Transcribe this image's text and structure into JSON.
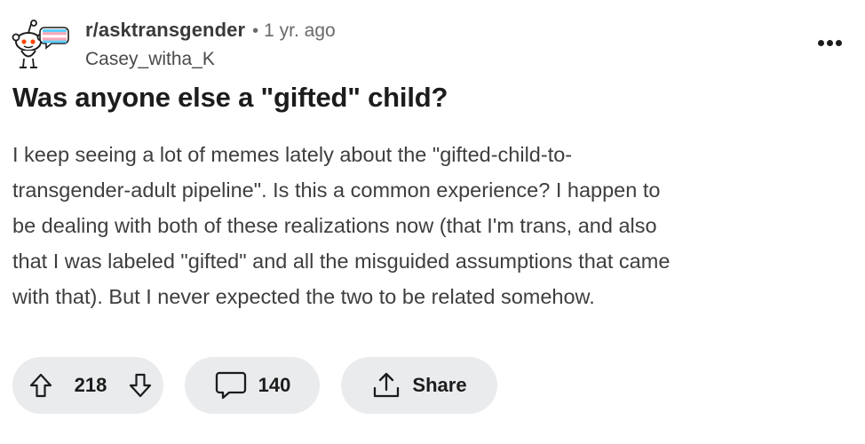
{
  "post": {
    "subreddit": "r/asktransgender",
    "separator": "•",
    "age": "1 yr. ago",
    "author": "Casey_witha_K",
    "title": "Was anyone else a \"gifted\" child?",
    "body_lines": [
      "I keep seeing a lot of memes lately about the \"gifted-child-to-",
      "transgender-adult pipeline\". Is this a common experience? I happen to",
      "be dealing with both of these realizations now (that I'm trans, and also",
      "that I was labeled \"gifted\" and all the misguided assumptions that came",
      "with that). But I never expected the two to be related somehow."
    ]
  },
  "actions": {
    "vote_count": "218",
    "comment_count": "140",
    "share_label": "Share"
  },
  "icons": {
    "avatar": "snoo-avatar-icon",
    "more": "more-options-icon",
    "upvote": "upvote-arrow-icon",
    "downvote": "downvote-arrow-icon",
    "comment": "comment-bubble-icon",
    "share": "share-icon"
  },
  "colors": {
    "text": "#1c1c1c",
    "muted": "#6a6a6a",
    "pill_bg": "#e9ebed",
    "snoo_eyes": "#ff4500",
    "flag_blue": "#5bcefa",
    "flag_pink": "#f5a9b8"
  }
}
